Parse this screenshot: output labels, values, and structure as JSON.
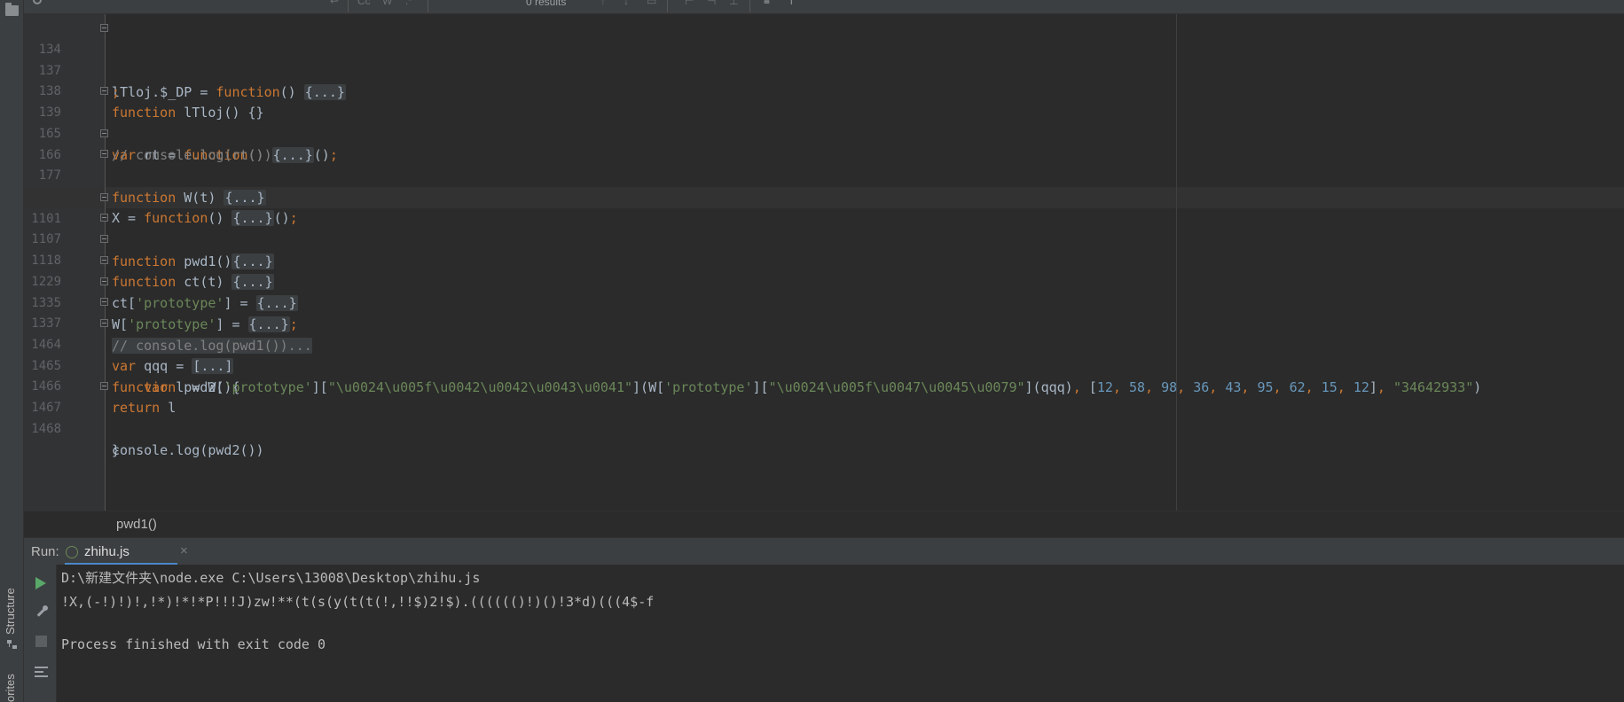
{
  "search_bar": {
    "results_text": "0 results"
  },
  "editor": {
    "lines": [
      {
        "num": "134"
      },
      {
        "num": "137"
      },
      {
        "num": "138"
      },
      {
        "num": "139"
      },
      {
        "num": "165"
      },
      {
        "num": "166"
      },
      {
        "num": "177"
      },
      {
        "num": "1101"
      },
      {
        "num": "1107"
      },
      {
        "num": "1118"
      },
      {
        "num": "1229"
      },
      {
        "num": "1335"
      },
      {
        "num": "1337"
      },
      {
        "num": "1464"
      },
      {
        "num": "1465"
      },
      {
        "num": "1466"
      },
      {
        "num": "1467"
      },
      {
        "num": "1468"
      }
    ]
  },
  "breadcrumb": {
    "text": "pwd1()"
  },
  "run_panel": {
    "label": "Run:",
    "tab_label": "zhihu.js",
    "close_glyph": "×",
    "console_lines": [
      "D:\\新建文件夹\\node.exe C:\\Users\\13008\\Desktop\\zhihu.js",
      "!X,(-!)!)!,!*)!*!*P!!!J)zw!**(t(s(y(t(t(!,!!$)2!$).(((((()!)()!3*d)(((4$-f",
      "",
      "Process finished with exit code 0"
    ]
  },
  "side_tabs": {
    "structure": "Structure",
    "favorites": "orites"
  },
  "colors": {
    "keyword": "#cc7832",
    "string": "#6a8759",
    "number": "#6897bb",
    "comment": "#808080",
    "run_icon": "#59a869",
    "tab_underline": "#4a88c7"
  },
  "icons": [
    "folder-icon",
    "search-icon",
    "play-icon",
    "wrench-icon",
    "stop-icon",
    "scroll-to-end-icon",
    "structure-icon",
    "nodejs-icon",
    "close-icon"
  ]
}
